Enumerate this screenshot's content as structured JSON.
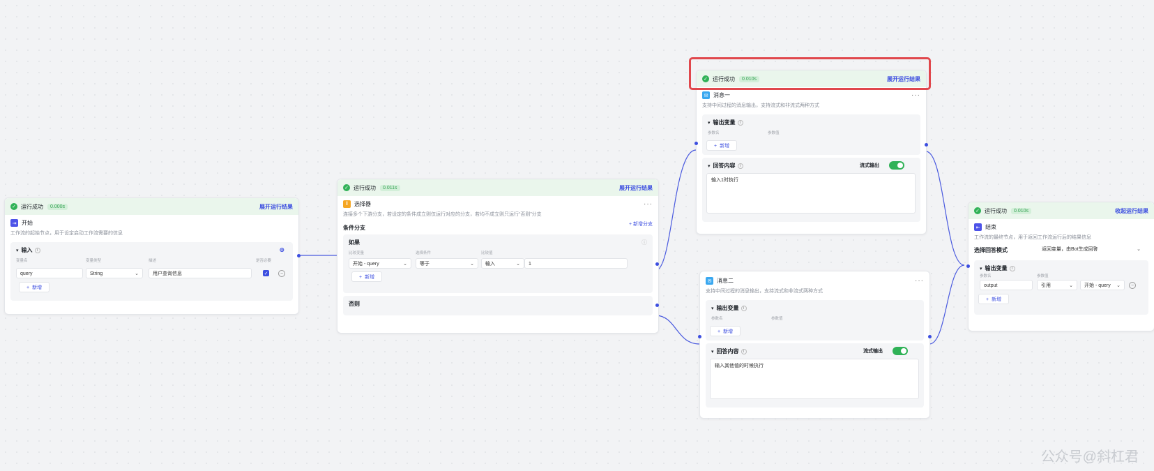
{
  "colors": {
    "accent": "#3c4ee0",
    "success": "#30b257",
    "highlight": "#e0474c"
  },
  "start_node": {
    "status": "运行成功",
    "duration": "0.000s",
    "action": "展开运行结果",
    "title": "开始",
    "icon": "start-icon",
    "desc": "工作流的起始节点，用于设定启动工作流需要的信息",
    "section": "输入",
    "columns": [
      "变量名",
      "变量类型",
      "描述",
      "是否必要"
    ],
    "row": {
      "name": "query",
      "type": "String",
      "description": "用户查询信息"
    },
    "add": "新增"
  },
  "selector_node": {
    "status": "运行成功",
    "duration": "0.011s",
    "action": "展开运行结果",
    "title": "选择器",
    "icon": "selector-icon",
    "desc": "连接多个下游分支，若设定的条件成立则仅运行对应的分支，若均不成立则只运行“否则”分支",
    "section": "条件分支",
    "add_branch": "新增分支",
    "if_label": "如果",
    "columns": [
      "比较变量",
      "选择条件",
      "比较值"
    ],
    "cond": {
      "var": "开始 - query",
      "op": "等于",
      "type": "输入",
      "value": "1"
    },
    "add": "新增",
    "else_label": "否则"
  },
  "message1_node": {
    "status": "运行成功",
    "duration": "0.010s",
    "action": "展开运行结果",
    "title": "消息一",
    "icon": "message-icon",
    "desc": "支持中间过程的消息输出，支持流式和非流式两种方式",
    "out_section": "输出变量",
    "columns": [
      "参数名",
      "参数值"
    ],
    "add": "新增",
    "reply_section": "回答内容",
    "stream": "流式输出",
    "reply": "输入1时执行"
  },
  "message2_node": {
    "title": "消息二",
    "icon": "message-icon",
    "desc": "支持中间过程的消息输出，支持流式和非流式两种方式",
    "out_section": "输出变量",
    "columns": [
      "参数名",
      "参数值"
    ],
    "add": "新增",
    "reply_section": "回答内容",
    "stream": "流式输出",
    "reply": "输入其他值的时候执行"
  },
  "end_node": {
    "status": "运行成功",
    "duration": "0.010s",
    "action": "收起运行结果",
    "title": "结束",
    "icon": "end-icon",
    "desc": "工作流的最终节点，用于返回工作流运行后的结果信息",
    "mode_label": "选择回答模式",
    "mode_value": "返回变量，由Bot生成回答",
    "out_section": "输出变量",
    "columns": [
      "参数名",
      "参数值"
    ],
    "row": {
      "name": "output",
      "type": "引用",
      "value": "开始 - query"
    },
    "add": "新增"
  },
  "watermark": "公众号@斜杠君"
}
